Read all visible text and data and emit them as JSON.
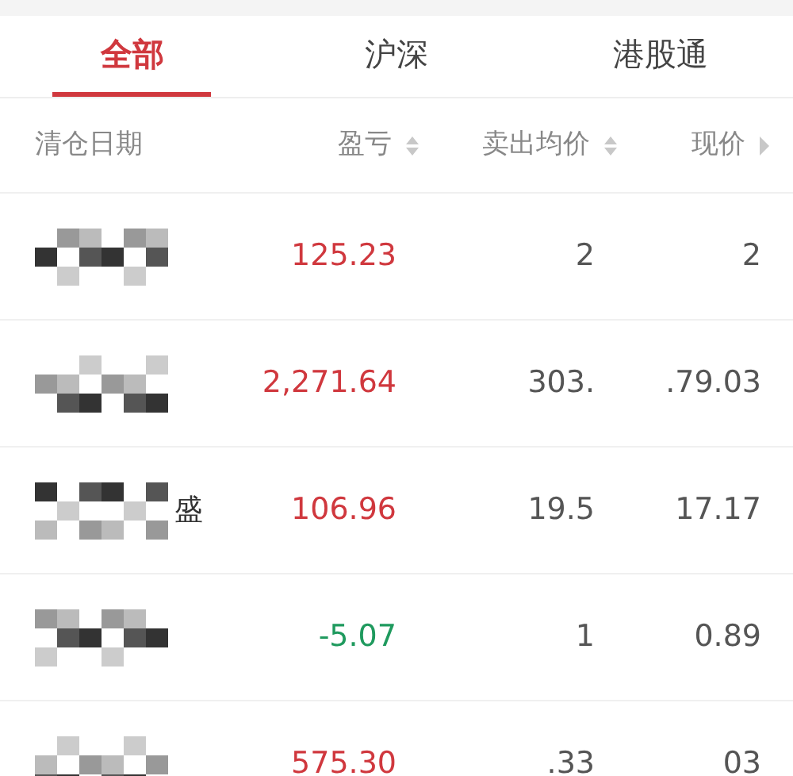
{
  "tabs": [
    {
      "label": "全部",
      "selected": true
    },
    {
      "label": "沪深",
      "selected": false
    },
    {
      "label": "港股通",
      "selected": false
    }
  ],
  "table": {
    "columns": [
      {
        "label": "清仓日期",
        "sortable": false
      },
      {
        "label": "盈亏",
        "sortable": true
      },
      {
        "label": "卖出均价",
        "sortable": true
      },
      {
        "label": "现价",
        "sortable": false
      }
    ],
    "rows": [
      {
        "profit": "125.23",
        "kind": "gain",
        "sell_price": "2",
        "current_price": "2"
      },
      {
        "profit": "2,271.64",
        "kind": "gain",
        "sell_price": "303.",
        "current_price": ".79.03"
      },
      {
        "name_fragment": "盛",
        "profit": "106.96",
        "kind": "gain",
        "sell_price": "19.5",
        "current_price": "17.17"
      },
      {
        "profit": "-5.07",
        "kind": "loss",
        "sell_price": "1",
        "current_price": "0.89"
      },
      {
        "profit": "575.30",
        "kind": "gain",
        "sell_price": ".33",
        "current_price": "03"
      }
    ]
  }
}
